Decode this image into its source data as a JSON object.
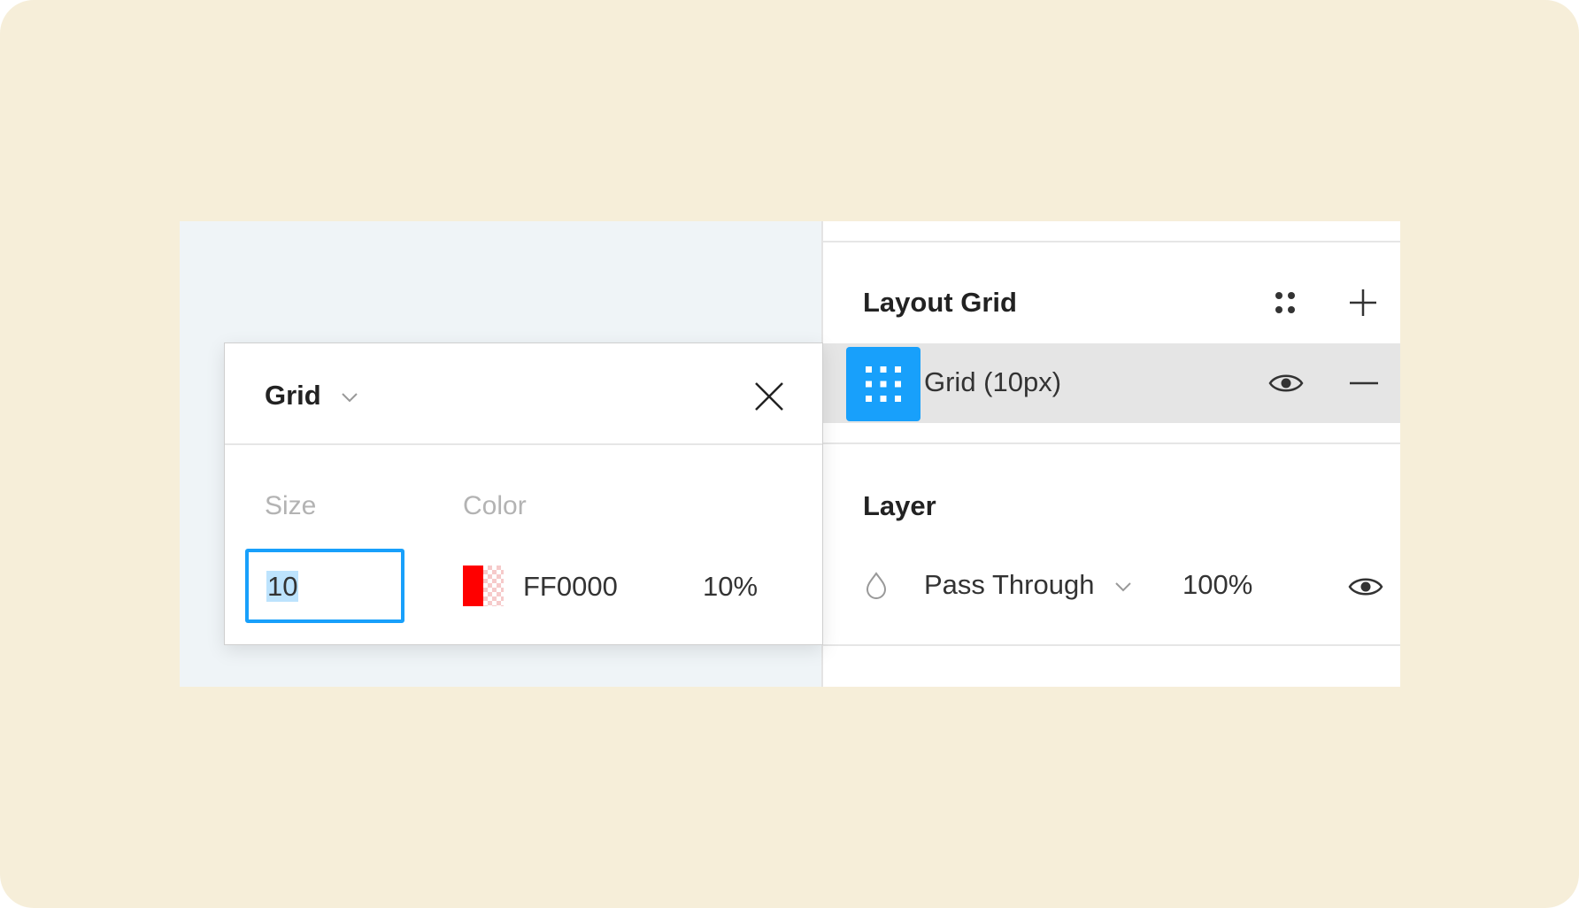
{
  "layout_grid": {
    "title": "Layout Grid",
    "styles_icon": "grid-styles-icon",
    "add_icon": "plus-icon",
    "item": {
      "label": "Grid (10px)",
      "chip_icon": "grid-icon",
      "visibility_icon": "eye-icon",
      "remove_icon": "minus-icon"
    }
  },
  "layer": {
    "title": "Layer",
    "blend_icon": "drop-icon",
    "blend_mode": "Pass Through",
    "opacity": "100%",
    "visibility_icon": "eye-icon"
  },
  "grid_popover": {
    "title": "Grid",
    "close_icon": "close-icon",
    "size_label": "Size",
    "size_value": "10",
    "color_label": "Color",
    "color_hex": "FF0000",
    "color_opacity": "10%"
  },
  "colors": {
    "backdrop": "#f6eed9",
    "canvas": "#eff4f7",
    "accent": "#18a0fb",
    "grid_color": "#ff0000",
    "selected_row": "#e5e5e5"
  }
}
